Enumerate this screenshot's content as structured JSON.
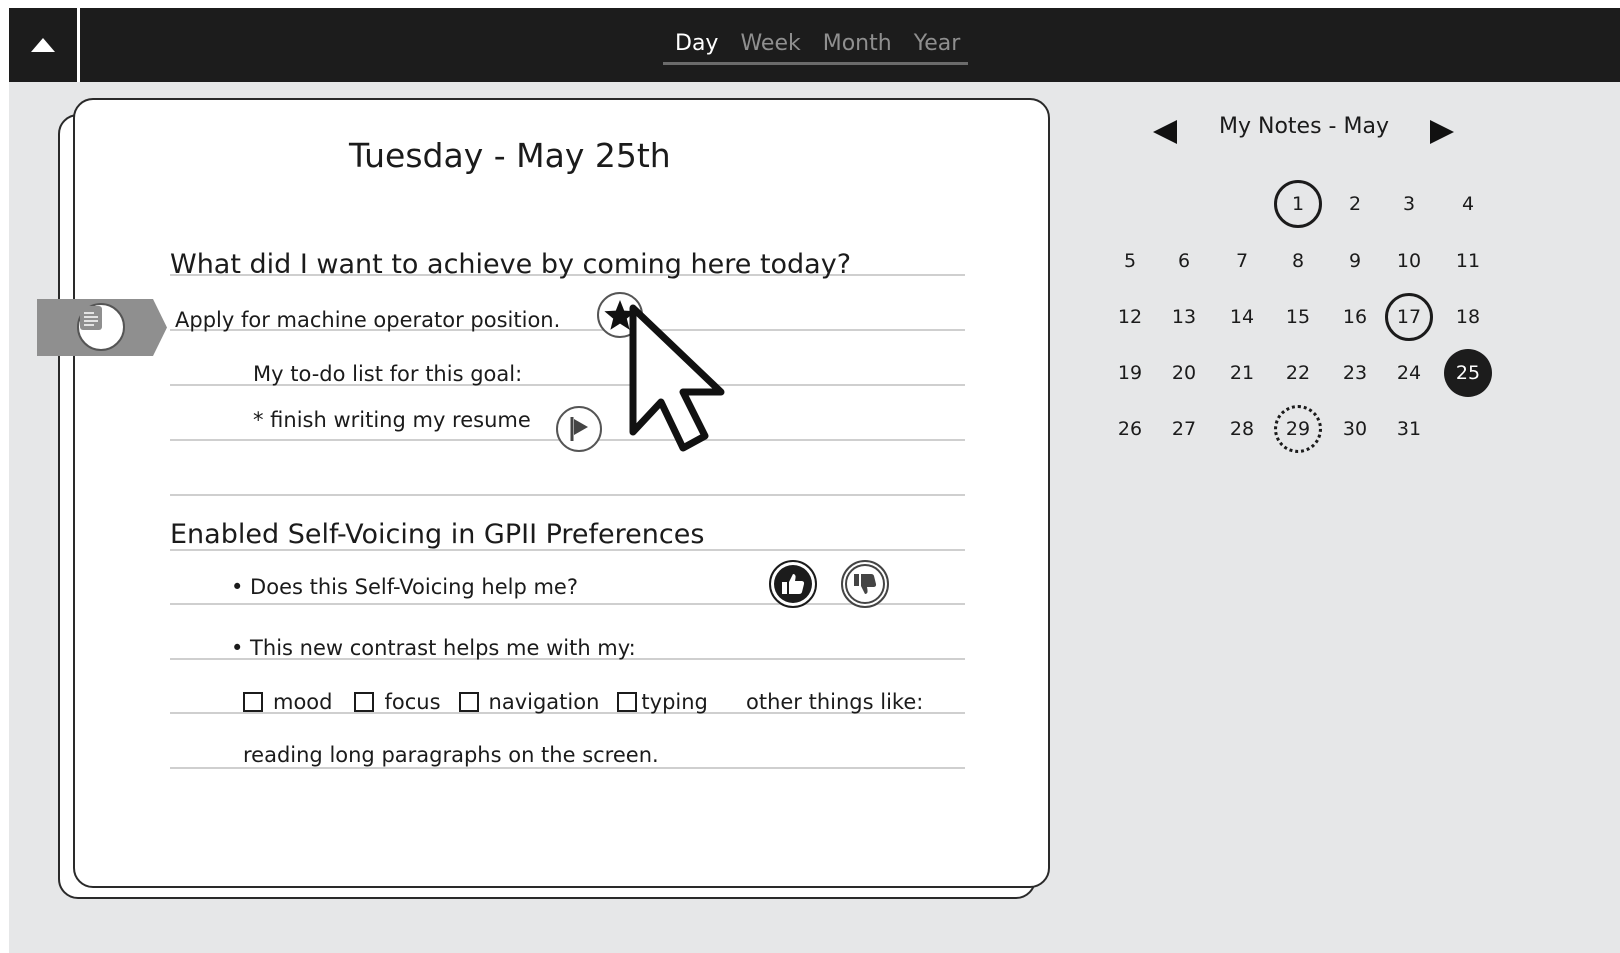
{
  "topbar": {
    "collapse_icon": "triangle-up-icon",
    "tabs": [
      {
        "label": "Day",
        "active": true
      },
      {
        "label": "Week",
        "active": false
      },
      {
        "label": "Month",
        "active": false
      },
      {
        "label": "Year",
        "active": false
      }
    ]
  },
  "page": {
    "title": "Tuesday - May 25th",
    "question": "What did I want to achieve by coming here today?",
    "goal": "Apply for machine operator position.",
    "todo_label": "My to-do list for this goal:",
    "todo_item": "* finish writing my resume",
    "section_heading": "Enabled Self-Voicing in GPII Preferences",
    "bullet1": "• Does this Self-Voicing help me?",
    "bullet2": "• This new contrast helps me with my:",
    "checkboxes": [
      {
        "label": "mood",
        "checked": false
      },
      {
        "label": "focus",
        "checked": false
      },
      {
        "label": "navigation",
        "checked": false
      },
      {
        "label": "typing",
        "checked": false
      }
    ],
    "other_label": "other things like:",
    "other_text": "reading long paragraphs on the screen."
  },
  "icons": {
    "bookmark": "note-icon",
    "goal_marker": "star-icon",
    "todo_marker": "flag-icon",
    "thumbs_up": "thumbs-up-icon",
    "thumbs_down": "thumbs-down-icon",
    "pointer": "mouse-pointer-icon"
  },
  "calendar": {
    "title": "My Notes - May",
    "days": [
      "1",
      "2",
      "3",
      "4",
      "5",
      "6",
      "7",
      "8",
      "9",
      "10",
      "11",
      "12",
      "13",
      "14",
      "15",
      "16",
      "17",
      "18",
      "19",
      "20",
      "21",
      "22",
      "23",
      "24",
      "25",
      "26",
      "27",
      "28",
      "29",
      "30",
      "31"
    ],
    "highlighted_days": [
      "1",
      "17"
    ],
    "selected_day": "25",
    "dotted_day": "29"
  },
  "colors": {
    "topbar_bg": "#1c1c1c",
    "frame_bg": "#e6e7e8",
    "bookmark_bg": "#8f8f8f",
    "ink": "#1b1b1b"
  }
}
